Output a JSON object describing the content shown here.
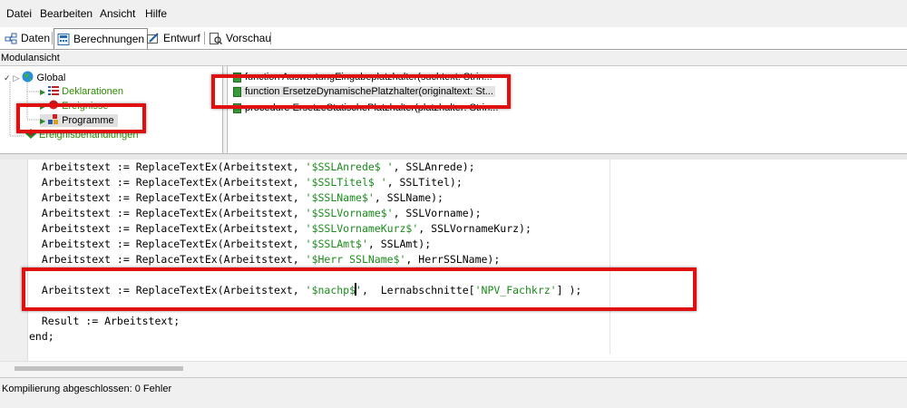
{
  "menu": [
    "Datei",
    "Bearbeiten",
    "Ansicht",
    "Hilfe"
  ],
  "tabs": [
    {
      "label": "Daten",
      "icon": "table-icon"
    },
    {
      "label": "Berechnungen",
      "icon": "calculator-icon",
      "active": true
    },
    {
      "label": "Entwurf",
      "icon": "edit-form-icon"
    },
    {
      "label": "Vorschau",
      "icon": "preview-icon"
    }
  ],
  "module_view": {
    "title": "Modulansicht",
    "tree": {
      "root": "Global",
      "children": [
        "Deklarationen",
        "Ereignisse",
        "Programme"
      ],
      "sibling": "Ereignisbehandlungen"
    },
    "items": [
      "function AuswertungEingabeplatzhalter(suchtext: Strin...",
      "function ErsetzeDynamischePlatzhalter(originaltext: St...",
      "procedure ErsetzeStatischePlatzhalter(platzhalter: Strin..."
    ]
  },
  "code": {
    "lines": [
      {
        "pre": "  Arbeitstext := ReplaceTextEx(Arbeitstext, ",
        "str": "'$SSLAnrede$ '",
        "post": ", SSLAnrede);"
      },
      {
        "pre": "  Arbeitstext := ReplaceTextEx(Arbeitstext, ",
        "str": "'$SSLTitel$ '",
        "post": ", SSLTitel);"
      },
      {
        "pre": "  Arbeitstext := ReplaceTextEx(Arbeitstext, ",
        "str": "'$SSLName$'",
        "post": ", SSLName);"
      },
      {
        "pre": "  Arbeitstext := ReplaceTextEx(Arbeitstext, ",
        "str": "'$SSLVorname$'",
        "post": ", SSLVorname);"
      },
      {
        "pre": "  Arbeitstext := ReplaceTextEx(Arbeitstext, ",
        "str": "'$SSLVornameKurz$'",
        "post": ", SSLVornameKurz);"
      },
      {
        "pre": "  Arbeitstext := ReplaceTextEx(Arbeitstext, ",
        "str": "'$SSLAmt$'",
        "post": ", SSLAmt);"
      },
      {
        "pre": "  Arbeitstext := ReplaceTextEx(Arbeitstext, ",
        "str": "'$Herr SSLName$'",
        "post": ", HerrSSLName);"
      }
    ],
    "highlight_line": {
      "pre": "  Arbeitstext := ReplaceTextEx(Arbeitstext, ",
      "str_a": "'$nachp$",
      "str_b": "'",
      "mid": ",  Lernabschnitte[",
      "str2": "'NPV_Fachkrz'",
      "post": "] );"
    },
    "result_line": "  Result := Arbeitstext;",
    "end_line": "end;"
  },
  "status": "Kompilierung abgeschlossen: 0 Fehler",
  "colors": {
    "highlight": "#e01010",
    "string": "#1a8c1a",
    "tree_green": "#2e8b00"
  }
}
